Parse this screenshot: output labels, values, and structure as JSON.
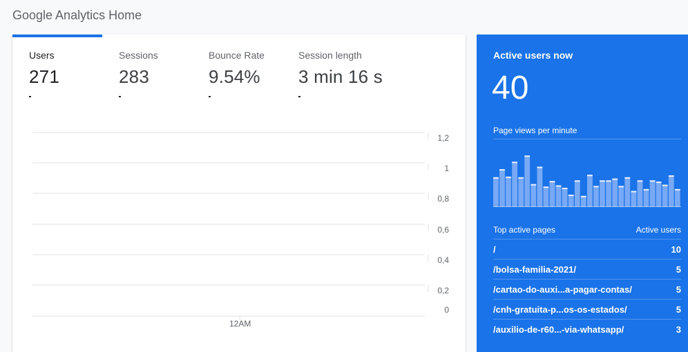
{
  "page": {
    "title": "Google Analytics Home"
  },
  "metrics": [
    {
      "label": "Users",
      "value": "271",
      "selected": true
    },
    {
      "label": "Sessions",
      "value": "283",
      "selected": false
    },
    {
      "label": "Bounce Rate",
      "value": "9.54%",
      "selected": false
    },
    {
      "label": "Session length",
      "value": "3 min 16 s",
      "selected": false
    }
  ],
  "chart": {
    "y_ticks": [
      "1,2",
      "1",
      "0,8",
      "0,6",
      "0,4",
      "0,2",
      "0"
    ],
    "x_tick": "12AM",
    "colors": {
      "grid": "#e0e0e0",
      "tab": "#1a73e8"
    }
  },
  "realtime": {
    "title": "Active users now",
    "count": "40",
    "subtitle": "Page views per minute",
    "bar_values": [
      0.48,
      0.61,
      0.49,
      0.73,
      0.48,
      0.83,
      0.37,
      0.65,
      0.33,
      0.42,
      0.35,
      0.31,
      0.2,
      0.43,
      0.18,
      0.52,
      0.34,
      0.43,
      0.43,
      0.46,
      0.34,
      0.48,
      0.26,
      0.43,
      0.29,
      0.43,
      0.41,
      0.36,
      0.51,
      0.29
    ],
    "bar_colors": {
      "fill": "#78a9f5",
      "cap": "#e8f0fe"
    },
    "top_pages_header": "Top active pages",
    "active_users_header": "Active users",
    "pages": [
      {
        "path": "/",
        "users": "10"
      },
      {
        "path": "/bolsa-familia-2021/",
        "users": "5"
      },
      {
        "path": "/cartao-do-auxi...a-pagar-contas/",
        "users": "5"
      },
      {
        "path": "/cnh-gratuita-p...os-os-estados/",
        "users": "5"
      },
      {
        "path": "/auxilio-de-r60...-via-whatsapp/",
        "users": "3"
      }
    ]
  }
}
